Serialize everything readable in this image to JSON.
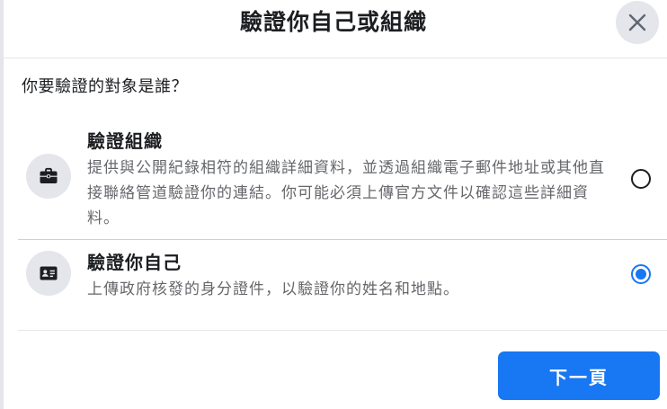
{
  "dialog": {
    "title": "驗證你自己或組織",
    "question": "你要驗證的對象是誰？",
    "close_icon": "close-icon"
  },
  "options": [
    {
      "icon": "briefcase-icon",
      "title": "驗證組織",
      "description": "提供與公開紀錄相符的組織詳細資料，並透過組織電子郵件地址或其他直接聯絡管道驗證你的連結。你可能必須上傳官方文件以確認這些詳細資料。",
      "selected": false
    },
    {
      "icon": "id-card-icon",
      "title": "驗證你自己",
      "description": "上傳政府核發的身分證件，以驗證你的姓名和地點。",
      "selected": true
    }
  ],
  "footer": {
    "next_label": "下一頁"
  },
  "colors": {
    "primary": "#1877f2",
    "icon_bg": "#e4e6eb",
    "text": "#1c1e21",
    "secondary_text": "#65676b"
  }
}
